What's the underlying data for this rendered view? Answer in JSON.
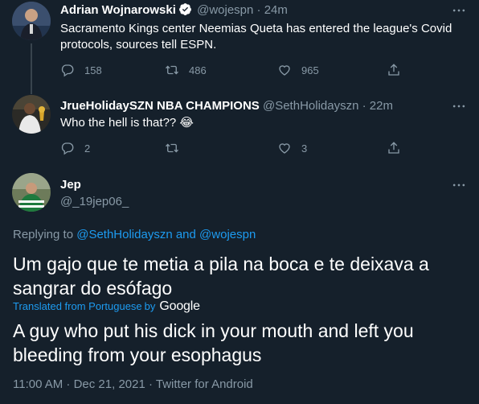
{
  "tweet1": {
    "author_name": "Adrian Wojnarowski",
    "verified": true,
    "handle": "@wojespn",
    "time": "24m",
    "text": "Sacramento Kings center Neemias Queta has entered the league's Covid protocols, sources tell ESPN.",
    "reply_count": "158",
    "retweet_count": "486",
    "like_count": "965"
  },
  "tweet2": {
    "author_name": "JrueHolidaySZN NBA CHAMPIONS",
    "handle": "@SethHolidayszn",
    "time": "22m",
    "text": "Who the hell is that?? 😂",
    "reply_count": "2",
    "retweet_count": "",
    "like_count": "3"
  },
  "main_tweet": {
    "author_name": "Jep",
    "handle": "@_19jep06_",
    "replying_prefix": "Replying to",
    "replying_user1": "@SethHolidayszn",
    "replying_and": "and",
    "replying_user2": "@wojespn",
    "text": "Um gajo que te metia a pila na boca e te deixava a sangrar do esófago",
    "translated_label": "Translated from Portuguese",
    "translated_by": "by",
    "translator": "Google",
    "translation": "A guy who put his dick in your mouth and left you bleeding from your esophagus",
    "timestamp": "11:00 AM · Dec 21, 2021 · Twitter for Android"
  },
  "icons": [
    "verified-badge-icon",
    "more-icon",
    "reply-icon",
    "retweet-icon",
    "like-icon",
    "share-icon"
  ],
  "colors": {
    "background": "#15202b",
    "text": "#ffffff",
    "muted": "#8899a6",
    "link": "#1d9bf0",
    "divider": "#38444d"
  }
}
